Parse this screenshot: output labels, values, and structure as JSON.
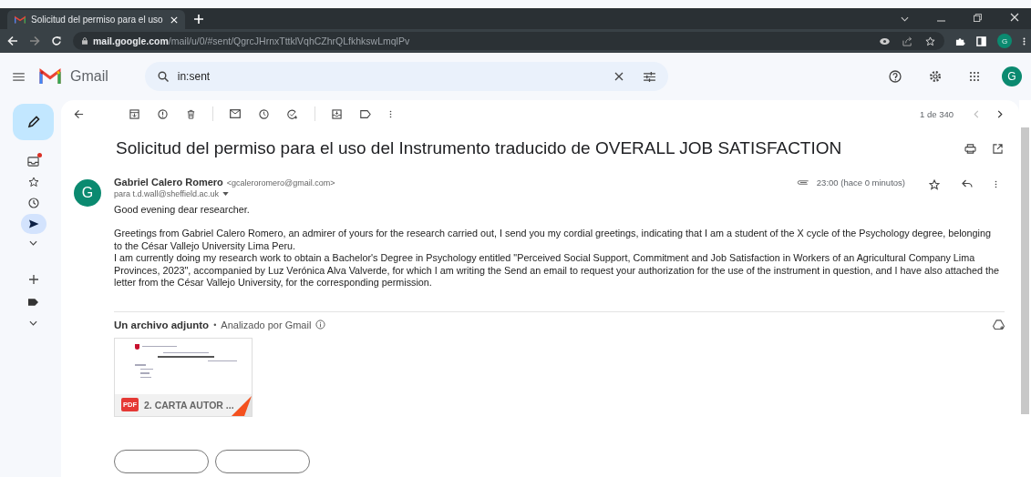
{
  "browser": {
    "tab_title": "Solicitud del permiso para el uso",
    "url_host": "mail.google.com",
    "url_path": "/mail/u/0/#sent/QgrcJHrnxTttklVqhCZhrQLfkhkswLmqlPv",
    "profile_initial": "G"
  },
  "header": {
    "app_name": "Gmail",
    "search": {
      "value": "in:sent"
    },
    "avatar_initial": "G"
  },
  "sidebar": {
    "items": [
      {
        "selected": false,
        "unread": true
      },
      {
        "selected": false,
        "unread": false
      },
      {
        "selected": false,
        "unread": false
      },
      {
        "selected": true,
        "unread": false
      }
    ]
  },
  "toolbar": {
    "pagination": "1 de 340"
  },
  "message": {
    "subject": "Solicitud del permiso para el uso del Instrumento traducido de OVERALL JOB SATISFACTION",
    "sender_initial": "G",
    "sender_name": "Gabriel Calero Romero",
    "sender_email": "<gcaleroromero@gmail.com>",
    "recipient": "para t.d.wall@sheffield.ac.uk",
    "time": "23:00 (hace 0 minutos)",
    "starred": false,
    "greeting": "Good evening dear researcher.",
    "paragraphs": [
      "Greetings from Gabriel Calero Romero, an admirer of yours for the research carried out, I send you my cordial greetings, indicating that I am a student of the X cycle of the Psychology degree, belonging to the César Vallejo University Lima Peru.",
      "I am currently doing my research work to obtain a Bachelor's Degree in Psychology entitled \"Perceived Social Support, Commitment and Job Satisfaction in Workers of an Agricultural Company Lima Provinces, 2023\", accompanied by Luz Verónica Alva Valverde, for which I am writing the Send an email to request your authorization for the use of the instrument in question, and I have also attached the letter from the César Vallejo University, for the corresponding permission."
    ]
  },
  "attachments": {
    "heading": "Un archivo adjunto",
    "separator": "•",
    "scan_note": "Analizado por Gmail",
    "files": [
      {
        "type_label": "PDF",
        "name": "2. CARTA AUTOR ..."
      }
    ]
  }
}
